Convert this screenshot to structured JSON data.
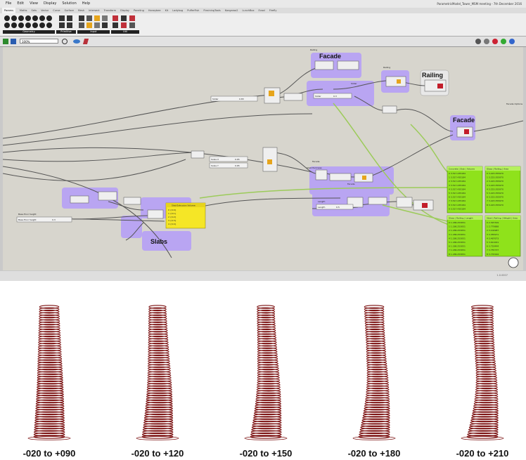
{
  "window": {
    "title": "ParametricModel_Tower_MSM meeting - 7th December 2016",
    "menu": [
      "File",
      "Edit",
      "View",
      "Display",
      "Solution",
      "Help"
    ]
  },
  "ribbon": {
    "tabs": [
      "Params",
      "Maths",
      "Sets",
      "Vector",
      "Curve",
      "Surface",
      "Mesh",
      "Intersect",
      "Transform",
      "Display",
      "Paneling",
      "Honeybee",
      "Kit",
      "Ladybug",
      "PufferFish",
      "FlexiningTools",
      "Kangaroo2",
      "LunchBox",
      "Evoxl",
      "Firefly"
    ],
    "active_tab": "Params",
    "groups": [
      "Geometry",
      "Primitive",
      "Input",
      "Util"
    ]
  },
  "toolbar": {
    "zoom": "100%"
  },
  "canvas": {
    "groups": [
      "Facade",
      "Railing",
      "Facade",
      "Slabs"
    ],
    "small_tags": [
      "Railing",
      "Railing",
      "Slider",
      "Facade Options",
      "Facade",
      "Facade",
      "Slab thickness",
      "Length",
      "Base floor height"
    ],
    "sliders": [
      {
        "label": "Slider",
        "value": "0.83"
      },
      {
        "label": "Slider",
        "value": "0.3"
      },
      {
        "label": "Scale X",
        "value": "0.65"
      },
      {
        "label": "Scale Y",
        "value": "0.65"
      },
      {
        "label": "Length",
        "value": "0.5"
      },
      {
        "label": "Base floor height",
        "value": "0.3"
      }
    ],
    "panels": [
      {
        "title": "Slab Extrusion Volume",
        "rows": [
          "0 {0;0}",
          "1 {0;1}",
          "2 {0;2}",
          "3 {0;3}",
          "4 {0;4}"
        ]
      },
      {
        "title": "Concrete | Slab | Volume",
        "rows": [
          "0 3.517.435184",
          "1 3.517.435184",
          "2 3.517.435184",
          "3 3.517.435184",
          "4 3.517.435184",
          "5 3.517.435184",
          "6 3.517.435184",
          "7 3.517.435184",
          "8 3.517.435184",
          "9 3.517.435184"
        ]
      },
      {
        "title": "Glass | Railing | Area",
        "rows": [
          "0 3.223.355970",
          "1 3.223.355970",
          "2 3.223.355970",
          "3 3.223.355970",
          "4 3.223.355970",
          "5 3.223.355970",
          "6 3.223.355970",
          "7 3.223.355970",
          "8 3.223.355970"
        ]
      },
      {
        "title": "Glass | Railing | Length",
        "rows": [
          "0 1.186.253051",
          "1 1.186.253051",
          "2 1.186.253051",
          "3 1.186.253051",
          "4 1.186.253051",
          "5 1.186.253051",
          "6 1.186.253051",
          "7 1.186.253051",
          "8 1.186.253051"
        ]
      },
      {
        "title": "Steel | Railing | Weight | Area",
        "rows": [
          "0 2.397329",
          "1 2.779888",
          "2 3.102987",
          "3 3.355971",
          "4 3.467673",
          "5 3.611001",
          "6 3.719444",
          "7 3.755737",
          "8 3.733194"
        ]
      }
    ],
    "status": "1.0.0007"
  },
  "variants": [
    {
      "caption": "-020 to +090",
      "twist": 0.2
    },
    {
      "caption": "-020 to +120",
      "twist": 0.45
    },
    {
      "caption": "-020 to +150",
      "twist": 0.65
    },
    {
      "caption": "-020 to +180",
      "twist": 0.85
    },
    {
      "caption": "-020 to +210",
      "twist": 1.0
    }
  ],
  "colors": {
    "group_fill": "#b9a5f2",
    "panel_yellow": "#f5e626",
    "panel_green": "#8fe21b",
    "wire": "#555555",
    "wire_green": "#9ccb5a",
    "tower": "#7a0f0f"
  }
}
